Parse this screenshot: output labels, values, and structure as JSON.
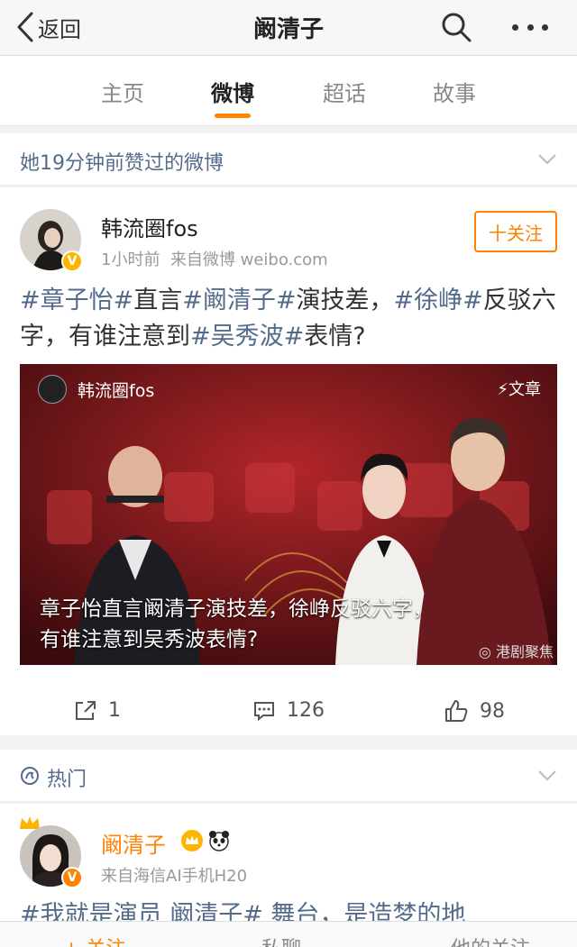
{
  "nav": {
    "back_label": "返回",
    "title": "阚清子"
  },
  "tabs": [
    {
      "label": "主页"
    },
    {
      "label": "微博"
    },
    {
      "label": "超话"
    },
    {
      "label": "故事"
    }
  ],
  "liked_section": {
    "header": "她19分钟前赞过的微博"
  },
  "post": {
    "author": "韩流圈fos",
    "time": "1小时前",
    "source": "来自微博 weibo.com",
    "follow_label": "十关注",
    "text": {
      "tag1": "#章子怡#",
      "t1": "直言",
      "tag2": "#阚清子#",
      "t2": "演技差，",
      "tag3": "#徐峥#",
      "t3": "反驳六字，有谁注意到",
      "tag4": "#吴秀波#",
      "t4": "表情?"
    },
    "media": {
      "author": "韩流圈fos",
      "type_label": "文章",
      "caption_line1": "章子怡直言阚清子演技差，徐峥反驳六字，",
      "caption_line2": "有谁注意到吴秀波表情?",
      "watermark": "港剧聚焦"
    },
    "actions": {
      "reposts": "1",
      "comments": "126",
      "likes": "98"
    }
  },
  "hot_section": {
    "header": "热门"
  },
  "hot_post": {
    "author": "阚清子",
    "source": "来自海信AI手机H20",
    "text_partial": "#我就是演员 阚清子# 舞台，是造梦的地"
  },
  "bottom_bar": {
    "follow": "+ 关注",
    "message": "私聊",
    "more": "他的关注"
  },
  "colors": {
    "accent": "#ff8200",
    "link": "#546b8c",
    "verified": "#ffb400"
  }
}
